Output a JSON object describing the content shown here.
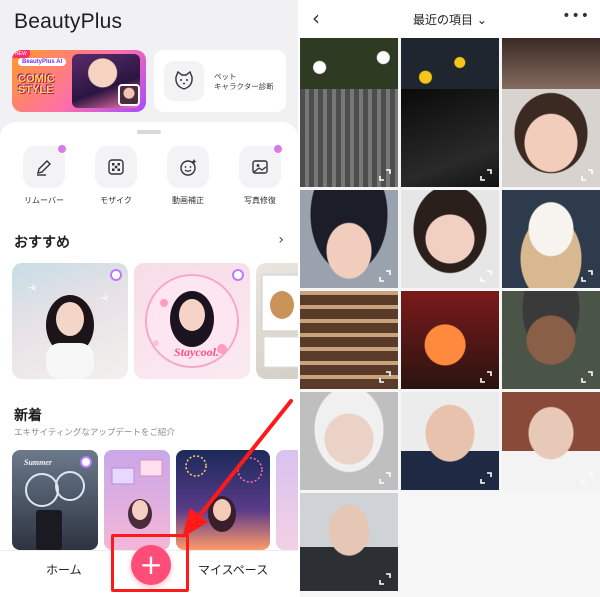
{
  "left_app": {
    "title": "BeautyPlus",
    "banners": {
      "comic": {
        "new_tag": "NEW",
        "chip": "BeautyPlus AI",
        "text_line1": "COMIC",
        "text_line2": "STYLE"
      },
      "pet": {
        "icon": "cat-face-icon",
        "label_line1": "ペット",
        "label_line2": "キャラクター診断"
      }
    },
    "tools": [
      {
        "label": "リムーバー",
        "icon": "pen-eraser-icon"
      },
      {
        "label": "モザイク",
        "icon": "mosaic-icon"
      },
      {
        "label": "動画補正",
        "icon": "face-smile-icon"
      },
      {
        "label": "写真修復",
        "icon": "photo-repair-icon"
      }
    ],
    "recommended": {
      "title": "おすすめ",
      "card2_caption": "Staycool."
    },
    "new_section": {
      "title": "新着",
      "subtitle": "エキサイティングなアップデートをご紹介",
      "card1_caption": "Summer"
    },
    "bottom_nav": {
      "home": "ホーム",
      "plus": "+",
      "myspace": "マイスペース"
    }
  },
  "right_app": {
    "album_title": "最近の項目",
    "album_dropdown_icon": "chevron-down-icon",
    "more_label": "•••",
    "photos": [
      "daisies-white",
      "flowers-yellow",
      "person-cropped",
      "building-facade",
      "dark-interior",
      "woman-bob-hair",
      "woman-cap",
      "woman-glasses",
      "shaved-ice-dessert",
      "bottle-shelf",
      "cocktail-bar",
      "elderly-man-cap",
      "elderly-woman-smiling",
      "elderly-man-suit",
      "elderly-woman-brick",
      "elderly-man-portrait"
    ]
  },
  "colors": {
    "accent_pink": "#ff4d79",
    "annotation_red": "#ff1a1a"
  }
}
